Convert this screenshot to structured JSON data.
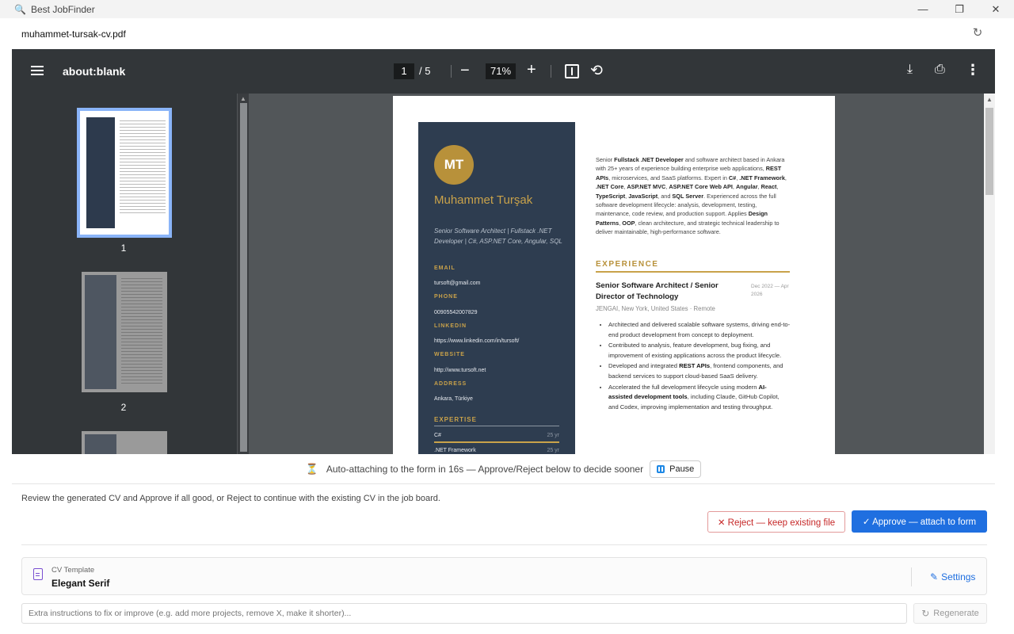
{
  "window": {
    "app_title": "Best JobFinder",
    "minimize": "—",
    "restore": "❐",
    "close": "✕"
  },
  "file": {
    "name": "muhammet-tursak-cv.pdf"
  },
  "pdf_toolbar": {
    "title": "about:blank",
    "current_page": "1",
    "page_sep": "/ 5",
    "zoom": "71%",
    "zoom_out": "−",
    "zoom_in": "+"
  },
  "thumbnails": [
    {
      "label": "1"
    },
    {
      "label": "2"
    }
  ],
  "cv": {
    "monogram": "MT",
    "name": "Muhammet Turşak",
    "role": "Senior Software Architect | Fullstack .NET Developer | C#, ASP.NET Core, Angular, SQL",
    "sections": {
      "email_label": "EMAIL",
      "email": "tursoft@gmail.com",
      "phone_label": "PHONE",
      "phone": "00905542007829",
      "linkedin_label": "LINKEDIN",
      "linkedin": "https://www.linkedin.com/in/tursoft/",
      "website_label": "WEBSITE",
      "website": "http://www.tursoft.net",
      "address_label": "ADDRESS",
      "address": "Ankara, Türkiye",
      "expertise_label": "EXPERTISE"
    },
    "skills": [
      {
        "name": "C#",
        "years": "25 yr"
      },
      {
        "name": ".NET Framework",
        "years": "25 yr"
      }
    ],
    "experience_title": "EXPERIENCE",
    "job_title": "Senior Software Architect / Senior Director of Technology",
    "job_date": "Dec 2022 — Apr 2026",
    "job_company": "JENGAI, New York, United States · Remote"
  },
  "autobar": {
    "message": "Auto-attaching to the form in 16s — Approve/Reject below to decide sooner",
    "pause": "Pause"
  },
  "review": {
    "text": "Review the generated CV and Approve if all good, or Reject to continue with the existing CV in the job board.",
    "reject": "✕  Reject — keep existing file",
    "approve": "✓  Approve — attach to form"
  },
  "template": {
    "label": "CV Template",
    "value": "Elegant Serif",
    "settings": "Settings"
  },
  "instructions": {
    "placeholder": "Extra instructions to fix or improve (e.g. add more projects, remove X, make it shorter)...",
    "regenerate": "Regenerate"
  },
  "colors": {
    "accent": "#1f6fe0",
    "reject": "#c62828",
    "cv_sidebar": "#2e3d50",
    "cv_gold": "#c9a24a"
  }
}
